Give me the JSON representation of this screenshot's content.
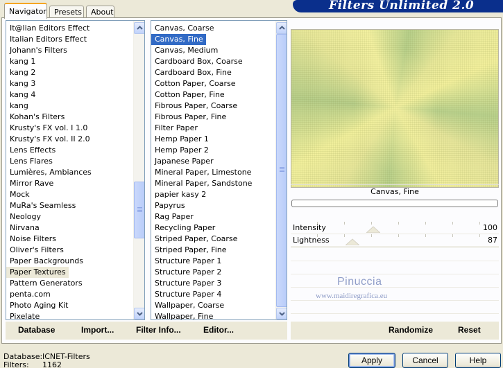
{
  "tabs": [
    "Navigator",
    "Presets",
    "About"
  ],
  "brand": "Filters Unlimited 2.0",
  "categories": [
    "It@lian Editors Effect",
    "Italian Editors Effect",
    "Johann's Filters",
    "kang 1",
    "kang 2",
    "kang 3",
    "kang 4",
    "kang",
    "Kohan's Filters",
    "Krusty's FX vol. I 1.0",
    "Krusty's FX vol. II 2.0",
    "Lens Effects",
    "Lens Flares",
    "Lumières, Ambiances",
    "Mirror Rave",
    "Mock",
    "MuRa's Seamless",
    "Neology",
    "Nirvana",
    "Noise Filters",
    "Oliver's Filters",
    "Paper Backgrounds",
    "Paper Textures",
    "Pattern Generators",
    "penta.com",
    "Photo Aging Kit",
    "Pixelate"
  ],
  "selected_category": "Paper Textures",
  "filters": [
    "Canvas, Coarse",
    "Canvas, Fine",
    "Canvas, Medium",
    "Cardboard Box, Coarse",
    "Cardboard Box, Fine",
    "Cotton Paper, Coarse",
    "Cotton Paper, Fine",
    "Fibrous Paper, Coarse",
    "Fibrous Paper, Fine",
    "Filter Paper",
    "Hemp Paper 1",
    "Hemp Paper 2",
    "Japanese Paper",
    "Mineral Paper, Limestone",
    "Mineral Paper, Sandstone",
    "papier kasy 2",
    "Papyrus",
    "Rag Paper",
    "Recycling Paper",
    "Striped Paper, Coarse",
    "Striped Paper, Fine",
    "Structure Paper 1",
    "Structure Paper 2",
    "Structure Paper 3",
    "Structure Paper 4",
    "Wallpaper, Coarse",
    "Wallpaper, Fine"
  ],
  "selected_filter": "Canvas, Fine",
  "preview_title": "Canvas, Fine",
  "sliders": [
    {
      "label": "Intensity",
      "value": "100",
      "level": 100
    },
    {
      "label": "Lightness",
      "value": "87",
      "level": 87
    }
  ],
  "left_buttons": {
    "database": "Database",
    "import": "Import...",
    "filter_info": "Filter Info...",
    "editor": "Editor..."
  },
  "right_buttons": {
    "randomize": "Randomize",
    "reset": "Reset"
  },
  "watermark": {
    "name": "Pinuccia",
    "site": "www.maidiregrafica.eu"
  },
  "status": {
    "database_label": "Database:",
    "database_value": "ICNET-Filters",
    "filters_label": "Filters:",
    "filters_value": "1162"
  },
  "dialog_buttons": {
    "apply": "Apply",
    "cancel": "Cancel",
    "help": "Help"
  },
  "colors": {
    "selection_blue": "#316ac5",
    "brand_blue": "#0a2f8c"
  }
}
